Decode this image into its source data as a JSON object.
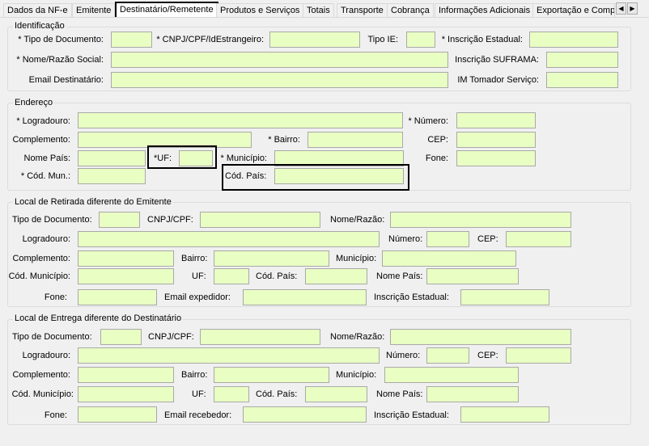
{
  "tabs": [
    "Dados da NF-e",
    "Emitente",
    "Destinatário/Remetente",
    "Produtos e Serviços",
    "Totais",
    "Transporte",
    "Cobrança",
    "Informações Adicionais",
    "Exportação e Compr"
  ],
  "scroll": {
    "left": "◀",
    "right": "▶"
  },
  "identificacao": {
    "legend": "Identificação",
    "tipo_doc": "* Tipo de Documento:",
    "cnpj": "* CNPJ/CPF/IdEstrangeiro:",
    "tipo_ie": "Tipo IE:",
    "inscr_est": "* Inscrição Estadual:",
    "nome": "* Nome/Razão Social:",
    "suframa": "Inscrição SUFRAMA:",
    "email": "Email Destinatário:",
    "im_tomador": "IM Tomador Serviço:"
  },
  "endereco": {
    "legend": "Endereço",
    "logradouro": "* Logradouro:",
    "numero": "* Número:",
    "complemento": "Complemento:",
    "bairro": "* Bairro:",
    "cep": "CEP:",
    "nome_pais": "Nome País:",
    "uf": "*UF:",
    "municipio": "* Município:",
    "fone": "Fone:",
    "cod_mun": "* Cód. Mun.:",
    "cod_pais": "Cód. País:"
  },
  "retirada": {
    "legend": "Local de Retirada diferente do Emitente",
    "tipo_doc": "Tipo de Documento:",
    "cnpj": "CNPJ/CPF:",
    "nome": "Nome/Razão:",
    "logradouro": "Logradouro:",
    "numero": "Número:",
    "cep": "CEP:",
    "complemento": "Complemento:",
    "bairro": "Bairro:",
    "municipio": "Município:",
    "cod_municipio": "Cód. Município:",
    "uf": "UF:",
    "cod_pais": "Cód. País:",
    "nome_pais": "Nome País:",
    "fone": "Fone:",
    "email": "Email expedidor:",
    "inscr_est": "Inscrição Estadual:"
  },
  "entrega": {
    "legend": "Local de Entrega diferente do Destinatário",
    "tipo_doc": "Tipo de Documento:",
    "cnpj": "CNPJ/CPF:",
    "nome": "Nome/Razão:",
    "logradouro": "Logradouro:",
    "numero": "Número:",
    "cep": "CEP:",
    "complemento": "Complemento:",
    "bairro": "Bairro:",
    "municipio": "Município:",
    "cod_municipio": "Cód. Município:",
    "uf": "UF:",
    "cod_pais": "Cód. País:",
    "nome_pais": "Nome País:",
    "fone": "Fone:",
    "email": "Email recebedor:",
    "inscr_est": "Inscrição Estadual:"
  },
  "colors": {
    "input_bg": "#e9fec3",
    "panel_bg": "#f0f0f0",
    "highlight": "#000000"
  }
}
